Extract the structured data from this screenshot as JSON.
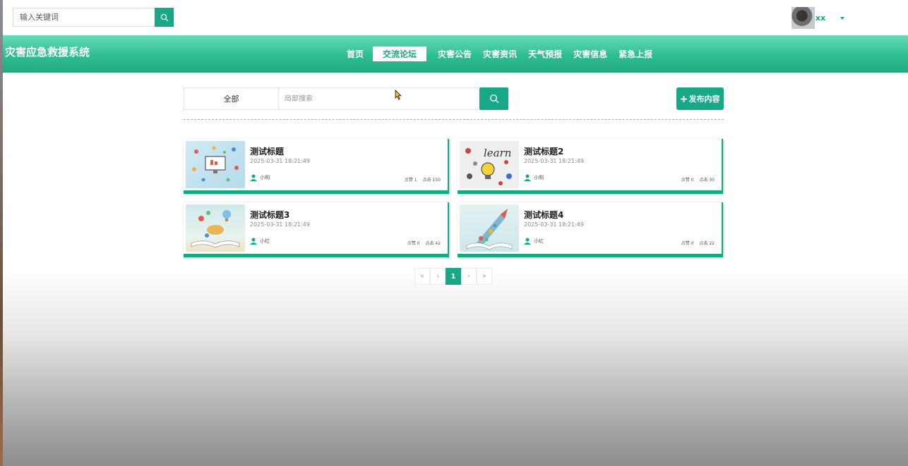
{
  "topbar": {
    "search_placeholder": "输入关键词",
    "username": "xx"
  },
  "header": {
    "brand": "灾害应急救援系统",
    "nav": [
      {
        "label": "首页",
        "active": false
      },
      {
        "label": "交流论坛",
        "active": true
      },
      {
        "label": "灾害公告",
        "active": false
      },
      {
        "label": "灾害资讯",
        "active": false
      },
      {
        "label": "天气预报",
        "active": false
      },
      {
        "label": "灾害信息",
        "active": false
      },
      {
        "label": "紧急上报",
        "active": false
      }
    ]
  },
  "toolbar": {
    "category": "全部",
    "search_placeholder": "局部搜索",
    "publish_label": "发布内容"
  },
  "posts": [
    {
      "title": "测试标题",
      "date": "2025-03-31 18:21:49",
      "author": "小明",
      "likes": "点赞 1",
      "clicks": "点击 150"
    },
    {
      "title": "测试标题2",
      "date": "2025-03-31 18:21:49",
      "author": "小明",
      "likes": "点赞 0",
      "clicks": "点击 30"
    },
    {
      "title": "测试标题3",
      "date": "2025-03-31 18:21:49",
      "author": "小红",
      "likes": "点赞 0",
      "clicks": "点击 42"
    },
    {
      "title": "测试标题4",
      "date": "2025-03-31 18:21:49",
      "author": "小红",
      "likes": "点赞 0",
      "clicks": "点击 22"
    }
  ],
  "pagination": {
    "first": "«",
    "prev": "‹",
    "current": "1",
    "next": "›",
    "last": "»"
  },
  "colors": {
    "accent": "#17a886"
  }
}
